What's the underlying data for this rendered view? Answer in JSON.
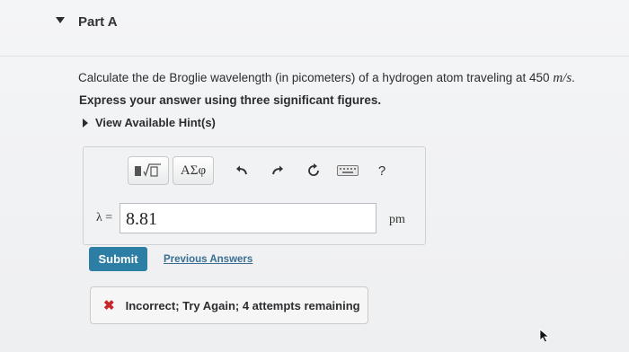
{
  "part": {
    "title": "Part A"
  },
  "question": {
    "text": "Calculate the de Broglie wavelength (in picometers) of a hydrogen atom traveling at 450 ",
    "unit": "m/s",
    "end": "."
  },
  "instruction": "Express your answer using three significant figures.",
  "hints": {
    "label": "View Available Hint(s)"
  },
  "toolbar": {
    "templates_icon": "templates-icon",
    "greek_label": "ΑΣφ",
    "undo_icon": "undo-icon",
    "redo_icon": "redo-icon",
    "reset_icon": "reset-icon",
    "keyboard_icon": "keyboard-icon",
    "help_label": "?"
  },
  "answer": {
    "variable": "λ =",
    "value": "8.81",
    "unit": "pm"
  },
  "actions": {
    "submit_label": "Submit",
    "previous_answers_label": "Previous Answers"
  },
  "feedback": {
    "icon": "x-mark-icon",
    "text": "Incorrect; Try Again; 4 attempts remaining",
    "color": "#c6272b"
  },
  "colors": {
    "submit_bg": "#2d7ea4",
    "link": "#3a6f93"
  }
}
